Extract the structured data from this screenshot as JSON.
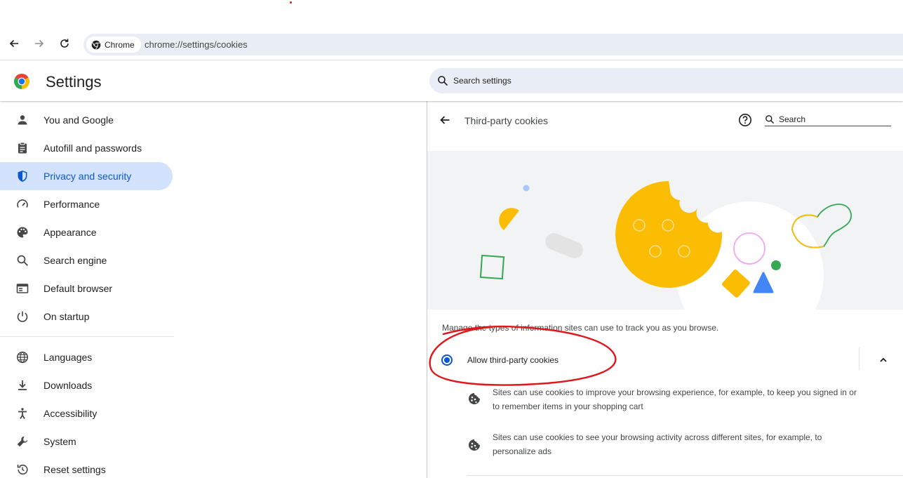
{
  "browser": {
    "chip_label": "Chrome",
    "url": "chrome://settings/cookies"
  },
  "header": {
    "title": "Settings",
    "search_placeholder": "Search settings"
  },
  "sidebar": {
    "items": [
      {
        "label": "You and Google",
        "icon": "person-icon"
      },
      {
        "label": "Autofill and passwords",
        "icon": "clipboard-icon"
      },
      {
        "label": "Privacy and security",
        "icon": "shield-icon",
        "active": true
      },
      {
        "label": "Performance",
        "icon": "speedometer-icon"
      },
      {
        "label": "Appearance",
        "icon": "palette-icon"
      },
      {
        "label": "Search engine",
        "icon": "search-icon"
      },
      {
        "label": "Default browser",
        "icon": "browser-window-icon"
      },
      {
        "label": "On startup",
        "icon": "power-icon"
      }
    ],
    "items2": [
      {
        "label": "Languages",
        "icon": "globe-icon"
      },
      {
        "label": "Downloads",
        "icon": "download-icon"
      },
      {
        "label": "Accessibility",
        "icon": "accessibility-icon"
      },
      {
        "label": "System",
        "icon": "wrench-icon"
      },
      {
        "label": "Reset settings",
        "icon": "reset-history-icon"
      }
    ]
  },
  "panel": {
    "title": "Third-party cookies",
    "search_placeholder": "Search",
    "description": "Manage the types of information sites can use to track you as you browse.",
    "option_label": "Allow third-party cookies",
    "bullets": [
      {
        "line1": "Sites can use cookies to improve your browsing experience, for example, to keep you signed in or",
        "line2": "to remember items in your shopping cart"
      },
      {
        "line1": "Sites can use cookies to see your browsing activity across different sites, for example, to",
        "line2": "personalize ads"
      }
    ]
  },
  "colors": {
    "accent": "#0b57d0",
    "active_bg": "#d3e3fd",
    "cookie": "#fbbc04",
    "annotation": "#e0161b"
  }
}
